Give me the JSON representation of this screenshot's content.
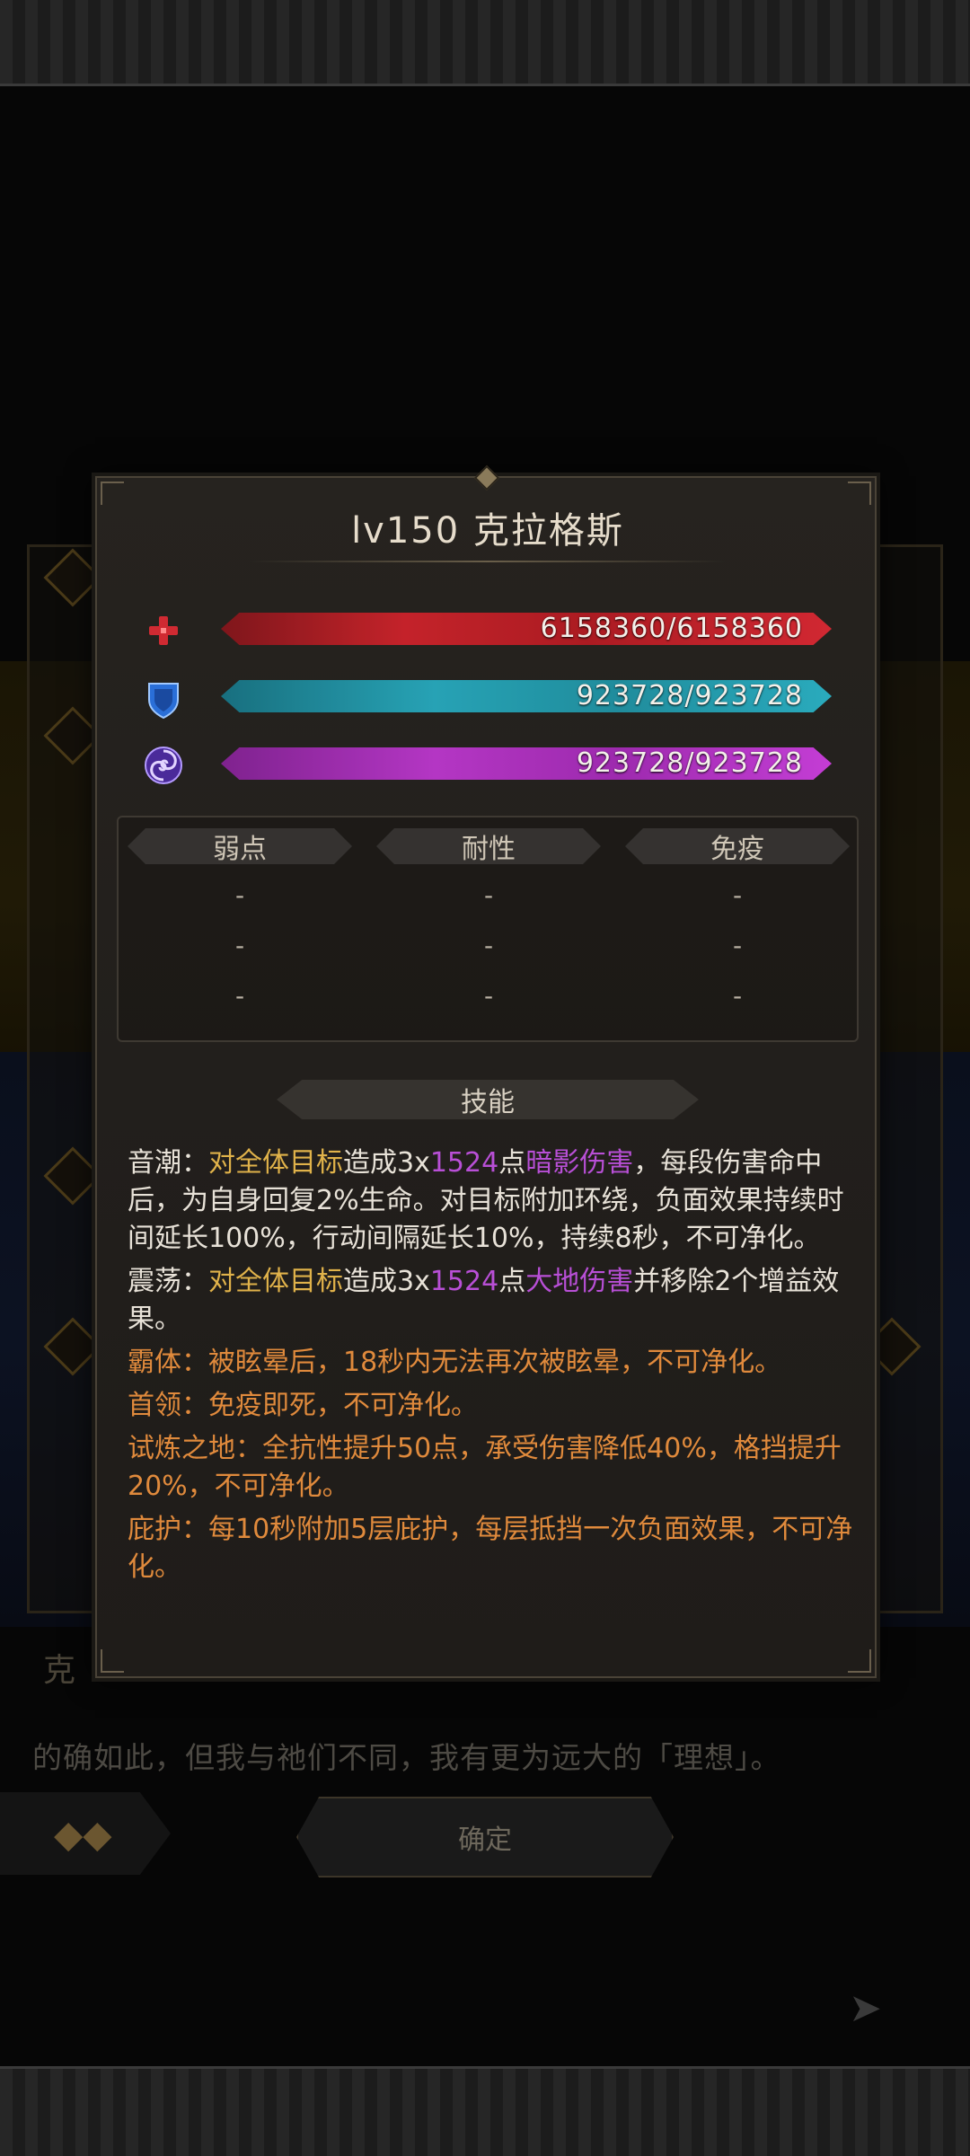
{
  "background": {
    "speaker_name": "克",
    "dialog_line": "的确如此，但我与祂们不同，我有更为远大的「理想」。",
    "confirm_label": "确定"
  },
  "modal": {
    "title": "lv150 克拉格斯",
    "stats": {
      "hp": {
        "icon": "health-cross-icon",
        "value": "6158360/6158360",
        "fill": 1.0,
        "color": "#c21a22"
      },
      "shield": {
        "icon": "shield-icon",
        "value": "923728/923728",
        "fill": 1.0,
        "color": "#1f9fb2"
      },
      "energy": {
        "icon": "swirl-energy-icon",
        "value": "923728/923728",
        "fill": 1.0,
        "color": "#b12ec2"
      }
    },
    "resistances": {
      "headers": [
        "弱点",
        "耐性",
        "免疫"
      ],
      "rows": [
        [
          "-",
          "-",
          "-"
        ],
        [
          "-",
          "-",
          "-"
        ],
        [
          "-",
          "-",
          "-"
        ]
      ]
    },
    "skills_header": "技能",
    "skills": {
      "s1": {
        "name": "音潮：",
        "p1": "对全体目标",
        "p2": "造成3x",
        "num": "1524",
        "p3": "点",
        "dmg": "暗影伤害",
        "rest": "，每段伤害命中后，为自身回复2%生命。对目标附加环绕，负面效果持续时间延长100%，行动间隔延长10%，持续8秒，不可净化。"
      },
      "s2": {
        "name": "震荡：",
        "p1": "对全体目标",
        "p2": "造成3x",
        "num": "1524",
        "p3": "点",
        "dmg": "大地伤害",
        "rest": "并移除2个增益效果。"
      },
      "s3": "霸体：被眩晕后，18秒内无法再次被眩晕，不可净化。",
      "s4": "首领：免疫即死，不可净化。",
      "s5": "试炼之地：全抗性提升50点，承受伤害降低40%，格挡提升20%，不可净化。",
      "s6": "庇护：每10秒附加5层庇护，每层抵挡一次负面效果，不可净化。"
    },
    "colors": {
      "gold": "#e0b24a",
      "purple": "#b84fd6",
      "orange": "#e08a3c"
    }
  }
}
